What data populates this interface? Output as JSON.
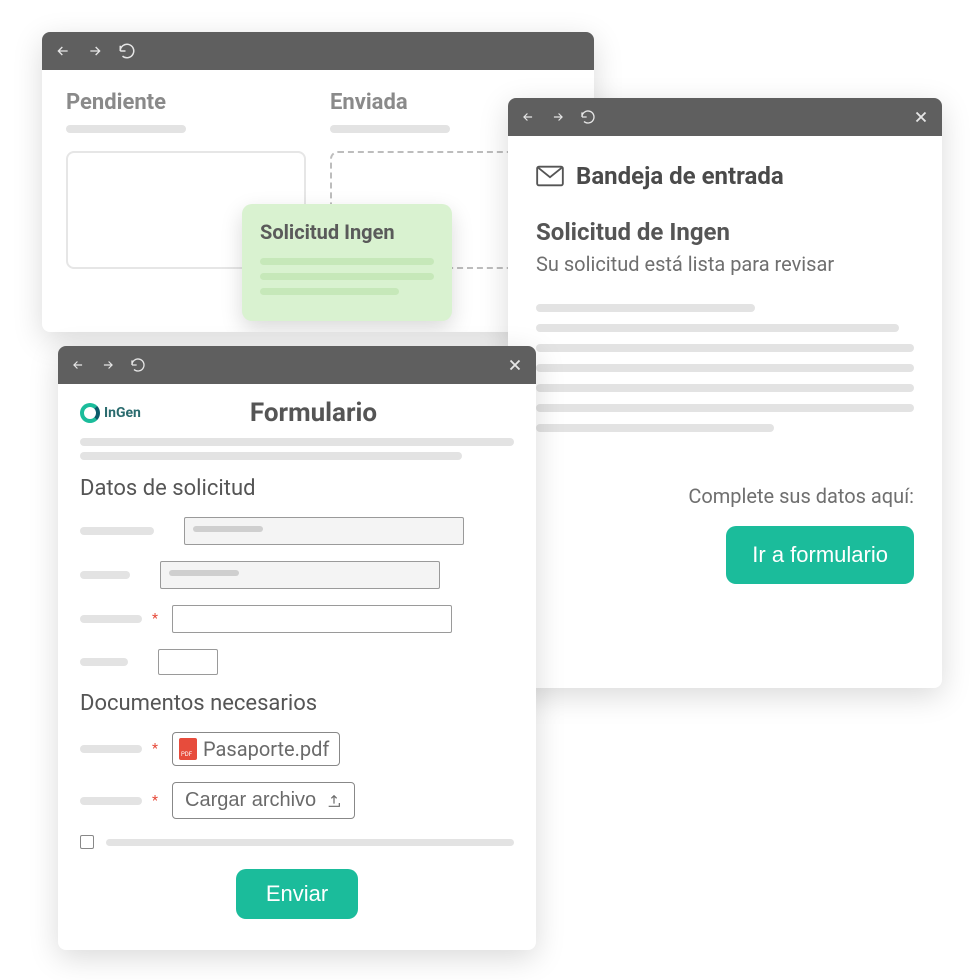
{
  "windowA": {
    "columns": [
      {
        "title": "Pendiente"
      },
      {
        "title": "Enviada"
      }
    ],
    "dragging_card": {
      "title": "Solicitud Ingen"
    }
  },
  "windowB": {
    "inbox_title": "Bandeja de entrada",
    "mail_title": "Solicitud de Ingen",
    "mail_subtitle": "Su solicitud está lista para revisar",
    "cta_text": "Complete sus datos aquí:",
    "cta_button": "Ir a formulario"
  },
  "windowC": {
    "brand": "InGen",
    "title": "Formulario",
    "section_data": "Datos de solicitud",
    "section_docs": "Documentos necesarios",
    "uploaded_file": "Pasaporte.pdf",
    "upload_label": "Cargar archivo",
    "submit_label": "Enviar"
  },
  "icons": {
    "required": "*"
  }
}
